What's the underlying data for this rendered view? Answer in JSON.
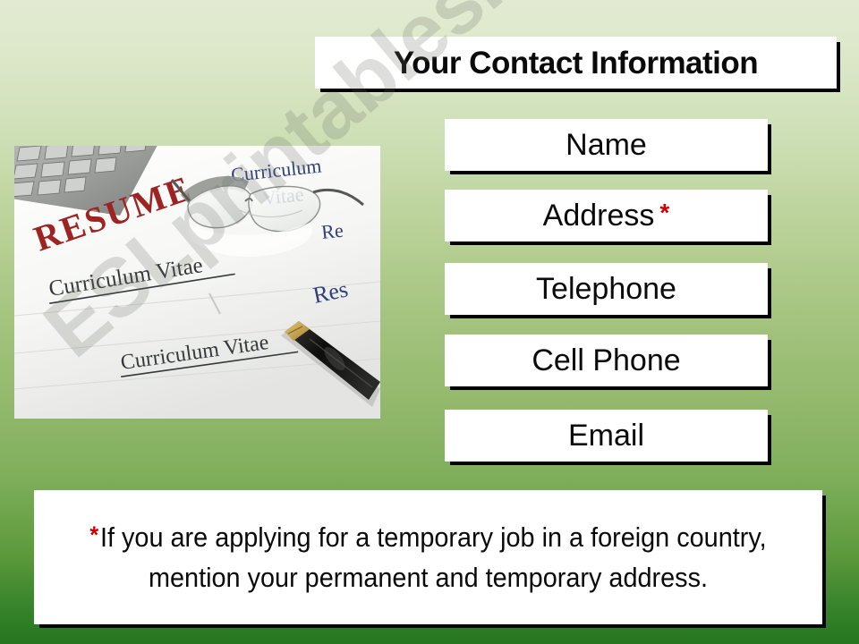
{
  "slide": {
    "background": {
      "top_color": "#e2ebd2",
      "mid_color": "#98ba6e",
      "bottom_color": "#26761f"
    },
    "watermark": {
      "text": "ESLprintables.com",
      "color": "#696e64"
    }
  },
  "header": {
    "title": "Your Contact Information"
  },
  "photo": {
    "alt": "Resume and Curriculum Vitae documents with eyeglasses, a keyboard and a fountain pen",
    "labels": {
      "resume": "RESUME",
      "cv_top_line1": "Curriculum",
      "cv_top_line2": "Vitae",
      "cv_mid": "Curriculum Vitae",
      "cv_bottom": "Curriculum Vitae",
      "re_fragment": "Re",
      "res_fragment": "Res"
    },
    "colors": {
      "resume_red": "#9e2323",
      "cv_blue": "#2f3f7a",
      "paper": "#f5f5f3",
      "keyboard": "#9a9c99",
      "pen": "#1a1a1a",
      "pen_nib": "#c9a24a"
    }
  },
  "contact_items": [
    {
      "label": "Name",
      "required": false,
      "marker": ""
    },
    {
      "label": "Address",
      "required": true,
      "marker": "*"
    },
    {
      "label": "Telephone",
      "required": false,
      "marker": ""
    },
    {
      "label": "Cell Phone",
      "required": false,
      "marker": ""
    },
    {
      "label": "Email",
      "required": false,
      "marker": ""
    }
  ],
  "note": {
    "marker": "*",
    "marker_color": "#cc0000",
    "text": "If you are applying for a temporary job in a foreign country, mention your permanent and temporary address."
  }
}
